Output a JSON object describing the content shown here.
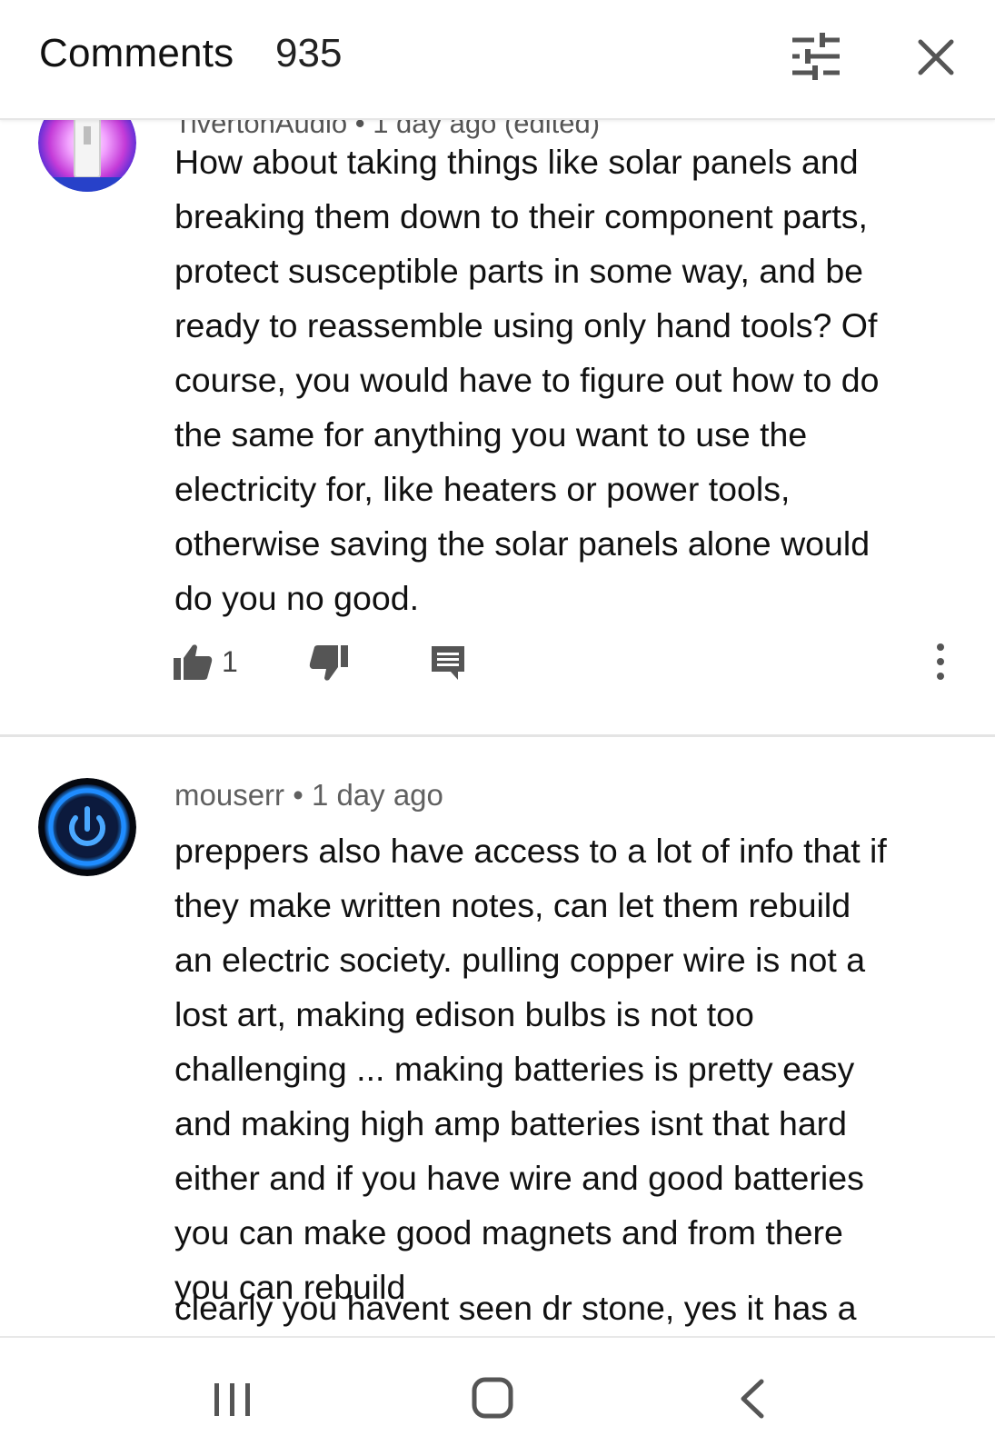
{
  "header": {
    "title": "Comments",
    "count": "935",
    "icons": {
      "filter": "sliders-icon",
      "close": "close-icon"
    }
  },
  "comments": [
    {
      "author_partial": "TivertonAudio • 1 day ago (edited)",
      "avatar_colors": [
        "#e23bd0",
        "#6b36ff",
        "#ffffff"
      ],
      "text": "How about taking things like solar panels and\nbreaking them down to their component parts,\nprotect susceptible parts in some way, and be\nready to reassemble using only hand tools?  Of\ncourse, you would have to figure out how to do\nthe same for anything you want to use the\nelectricity for, like heaters or power tools,\notherwise saving the solar panels alone would\ndo you no good.",
      "likes": "1"
    },
    {
      "author": "mouserr",
      "separator": "•",
      "time": "1 day ago",
      "avatar_colors": [
        "#0a1a3a",
        "#1e90ff"
      ],
      "text": "preppers also have access to a lot of info that if\nthey make written notes, can let them rebuild\nan electric society. pulling copper wire is not a\nlost art, making edison bulbs is not too\nchallenging ... making batteries is pretty easy\nand making high amp batteries isnt that hard\neither and if you have wire and good batteries\nyou can make good magnets and from there\nyou can rebuild",
      "text_cut_line": "clearly you havent seen dr stone, yes it has a"
    }
  ],
  "nav": {
    "recents": "recents-icon",
    "home": "home-icon",
    "back": "back-icon"
  },
  "colors": {
    "status_dot": "#e52222",
    "text": "#111111",
    "meta": "#606060",
    "icon": "#555555"
  }
}
